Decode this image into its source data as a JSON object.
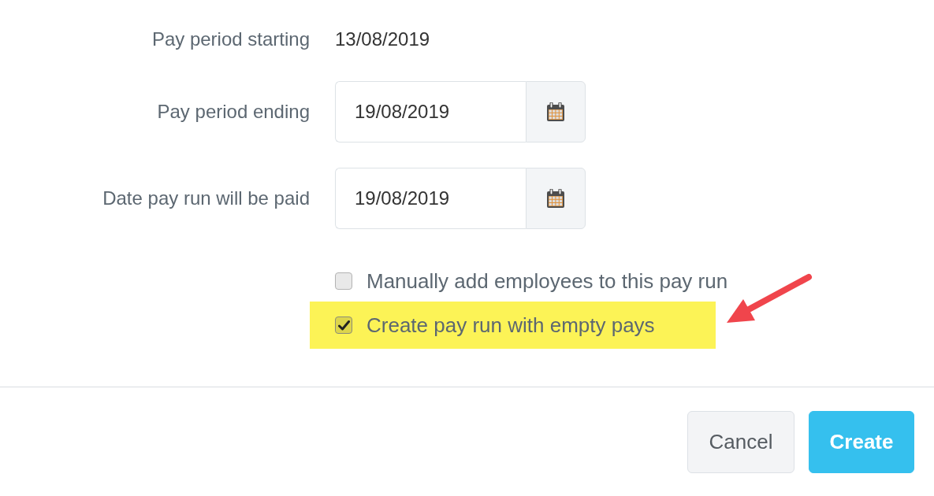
{
  "fields": [
    {
      "kind": "text",
      "label": "Pay period starting",
      "value": "13/08/2019"
    },
    {
      "kind": "date",
      "label": "Pay period ending",
      "value": "19/08/2019"
    },
    {
      "kind": "date",
      "label": "Date pay run will be paid",
      "value": "19/08/2019"
    }
  ],
  "options": [
    {
      "label": "Manually add employees to this pay run",
      "checked": false,
      "highlighted": false
    },
    {
      "label": "Create pay run with empty pays",
      "checked": true,
      "highlighted": true
    }
  ],
  "buttons": [
    {
      "label": "Cancel",
      "kind": "secondary"
    },
    {
      "label": "Create",
      "kind": "primary"
    }
  ]
}
